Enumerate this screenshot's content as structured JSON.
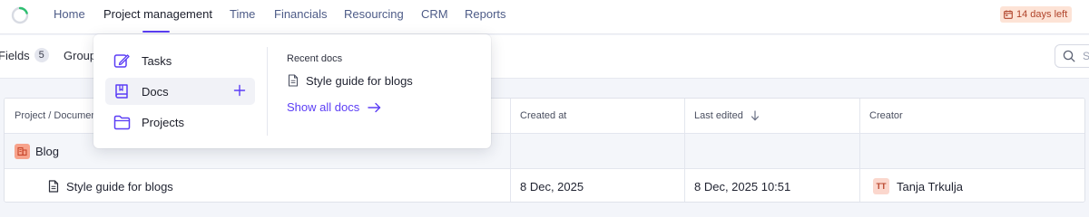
{
  "nav": {
    "items": [
      {
        "label": "Home"
      },
      {
        "label": "Project management"
      },
      {
        "label": "Time"
      },
      {
        "label": "Financials"
      },
      {
        "label": "Resourcing"
      },
      {
        "label": "CRM"
      },
      {
        "label": "Reports"
      }
    ],
    "active": "Project management",
    "trial_badge": "14 days left"
  },
  "toolbar": {
    "fields_label": "Fields",
    "fields_count": "5",
    "group_label": "Group",
    "search_placeholder": "S"
  },
  "table": {
    "columns": [
      "Project / Documen",
      "Created at",
      "Last edited",
      "Creator"
    ],
    "group_row": {
      "name": "Blog"
    },
    "rows": [
      {
        "name": "Style guide for blogs",
        "created_at": "8 Dec, 2025",
        "last_edited": "8 Dec, 2025 10:51",
        "creator_initials": "TT",
        "creator": "Tanja Trkulja"
      }
    ]
  },
  "dropdown": {
    "items": [
      {
        "label": "Tasks",
        "icon": "tasks-icon"
      },
      {
        "label": "Docs",
        "icon": "docs-icon"
      },
      {
        "label": "Projects",
        "icon": "folder-icon"
      }
    ],
    "recent_title": "Recent docs",
    "recent_doc": "Style guide for blogs",
    "show_all": "Show all docs"
  },
  "colors": {
    "accent": "#5b3df5",
    "nav_text": "#4d5b87",
    "trial_bg": "#fde3d6",
    "trial_text": "#b0432a",
    "blog_icon": "#f7a38c"
  }
}
